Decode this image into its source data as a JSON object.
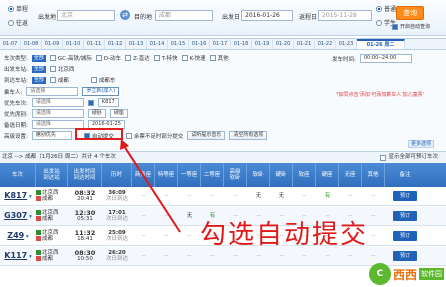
{
  "search": {
    "trip_single": "单程",
    "trip_round": "往返",
    "from_label": "出发地",
    "from_value": "北京",
    "to_label": "目的地",
    "to_value": "成都",
    "depart_label": "出发日",
    "depart_value": "2016-01-26",
    "return_label": "返程日",
    "return_value": "2015-11-28",
    "type_normal": "普通",
    "type_student": "学生",
    "query_button": "查询",
    "auto_query": "开启自动查询"
  },
  "date_tabs": [
    "01-07",
    "01-08",
    "01-09",
    "01-10",
    "01-11",
    "01-12",
    "01-13",
    "01-14",
    "01-15",
    "01-16",
    "01-17",
    "01-18",
    "01-19",
    "01-20",
    "01-21",
    "01-22",
    "01-23"
  ],
  "date_tab_current": "01-26 周二",
  "filters": {
    "train_type_label": "车次类型:",
    "all": "全部",
    "train_types": [
      "GC-高铁/城际",
      "D-动车",
      "Z-直达",
      "T-特快",
      "K-快速",
      "其他"
    ],
    "depart_station_label": "出发车站:",
    "depart_stations": [
      "北京西"
    ],
    "arrive_station_label": "到达车站:",
    "arrive_stations": [
      "成都",
      "成都东"
    ],
    "depart_time_label": "发车时间:",
    "depart_time_value": "00:00--24:00"
  },
  "booking": {
    "passenger_label": "乘车人:",
    "passenger_placeholder": "请选择",
    "passenger_selected": "罗立新(成人)",
    "priority_train_label": "优先车次:",
    "priority_train_placeholder": "请选择",
    "priority_train_value": "K817",
    "priority_seat_label": "优先席别:",
    "priority_seat_placeholder": "请选择",
    "priority_seat_values": [
      "硬卧",
      "硬座"
    ],
    "backup_date_label": "备选日期:",
    "backup_date_placeholder": "请选择",
    "backup_date_value": "2016-01-25",
    "advanced_label": "高级设置:",
    "advanced_value": "席别优先",
    "auto_submit": "自动提交",
    "partial_submit": "余票不足时部分提交",
    "test_button": "试听提示音乐",
    "clear_button": "清空所有选项",
    "warning": "*如同点击'添加'可添加乘车人'加儿童票'",
    "more_options": "更多选项"
  },
  "summary": {
    "route": "北京 --> 成都（1月26日 周二）共计",
    "count": "4",
    "unit": "个车次",
    "show_all_label": "显示全部可预订车次"
  },
  "table": {
    "headers": [
      "车次",
      "出发站\n到达站",
      "出发时间\n到达时间",
      "历时",
      "商务座",
      "特等座",
      "一等座",
      "二等座",
      "高级\n软卧",
      "软卧",
      "硬卧",
      "软座",
      "硬座",
      "无座",
      "其他",
      "备注"
    ],
    "rows": [
      {
        "train": "K817",
        "from": "北京西",
        "to": "成都",
        "dep": "08:32",
        "arr": "20:41",
        "dur": "36:09",
        "day": "次日到达",
        "cells": [
          "--",
          "--",
          "--",
          "--",
          "--",
          "无",
          "无",
          "--",
          "有",
          "--",
          "--"
        ],
        "action": "预订"
      },
      {
        "train": "G307",
        "from": "北京西",
        "to": "成都",
        "dep": "12:30",
        "arr": "05:31",
        "dur": "17:01",
        "day": "次日到达",
        "cells": [
          "--",
          "--",
          "无",
          "有",
          "--",
          "--",
          "--",
          "--",
          "--",
          "--",
          "--"
        ],
        "action": "预订"
      },
      {
        "train": "Z49",
        "from": "北京西",
        "to": "成都",
        "dep": "11:32",
        "arr": "18:41",
        "dur": "25:09",
        "day": "次日到达",
        "cells": [
          "--",
          "--",
          "--",
          "--",
          "--",
          "--",
          "--",
          "--",
          "--",
          "--",
          "--"
        ],
        "action": "预订"
      },
      {
        "train": "K117",
        "from": "北京西",
        "to": "成都",
        "dep": "08:30",
        "arr": "10:50",
        "dur": "26:20",
        "day": "次日到达",
        "cells": [
          "--",
          "--",
          "--",
          "--",
          "--",
          "--",
          "--",
          "--",
          "--",
          "--",
          "--"
        ],
        "action": "预订"
      }
    ]
  },
  "annotation": "勾选自动提交",
  "watermark": {
    "logo": "C",
    "text": "西西",
    "tag": "软件园"
  },
  "colors": {
    "accent": "#1f62b8",
    "header": "#2f6fbd",
    "query": "#ff8c1a",
    "annotation": "#e01a1a"
  }
}
